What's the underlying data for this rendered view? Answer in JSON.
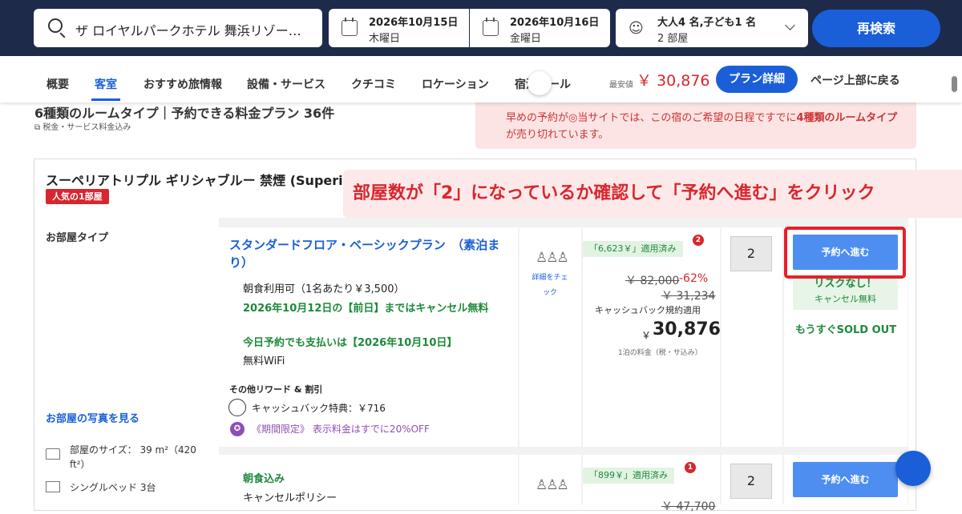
{
  "search": {
    "hotel": "ザ ロイヤルパークホテル 舞浜リゾー…",
    "checkin_date": "2026年10月15日",
    "checkin_day": "木曜日",
    "checkout_date": "2026年10月16日",
    "checkout_day": "金曜日",
    "guests": "大人4 名,子ども1 名",
    "rooms": "2 部屋",
    "button": "再検索"
  },
  "nav": {
    "tabs": [
      "概要",
      "客室",
      "おすすめ旅情報",
      "設備・サービス",
      "クチコミ",
      "ロケーション",
      "宿泊ルール"
    ],
    "active_tab": "客室",
    "lowest_label": "最安値",
    "lowest_price": "￥ 30,876",
    "plan_detail_button": "プラン詳細",
    "back_to_top": "ページ上部に戻る"
  },
  "summary": {
    "title": "6種類のルームタイプ｜予約できる料金プラン 36件",
    "tax_note": "税金・サービス料金込み",
    "alert_prefix": "早めの予約が◎当サイトでは、この宿のご希望の日程ですでに",
    "alert_bold": "4種類のルームタイプ",
    "alert_suffix": "が売り切れています。"
  },
  "annotation_banner": "部屋数が「2」になっているか確認して「予約へ進む」をクリック",
  "room": {
    "title": "スーペリアトリプル ギリシャブルー 禁煙 (Superior",
    "popular_badge": "人気の1部屋",
    "room_type_label": "お部屋タイプ",
    "photo_link": "お部屋の写真を見る",
    "size": "部屋のサイズ： 39 m²（420 ft²）",
    "beds": "シングルベッド 3台"
  },
  "plan1": {
    "name": "スタンダードフロア・ベーシックプラン　（素泊まり）",
    "breakfast": "朝食利用可（1名あたり￥3,500）",
    "cancel": "2026年10月12日の【前日】まではキャンセル無料",
    "pay": "今日予約でも支払いは【2026年10月10日】",
    "wifi": "無料WiFi",
    "rewards_title": "その他リワード & 割引",
    "cashback": "キャッシュバック特典：￥716",
    "limited": "《期間限定》 表示料金はすでに20%OFF",
    "detail_link": "詳細をチェック",
    "coupon": "「6,623￥」適用済み",
    "coupon_count": "2",
    "original_price": "￥ 82,000",
    "discount": "-62%",
    "price_after_coupon": "￥ 31,234",
    "cashback_rule": "キャッシュバック規約適用",
    "currency": "￥",
    "price": "30,876",
    "per_night": "1泊の料金（税・サ込み）",
    "quantity": "2",
    "reserve_button": "予約へ進む",
    "risk_main": "リスクなし！",
    "risk_sub": "キャンセル無料",
    "soldout": "もうすぐSOLD OUT"
  },
  "plan2": {
    "title": "朝食込み",
    "policy": "キャンセルポリシー",
    "coupon": "「899￥」適用済み",
    "coupon_count": "1",
    "original_price": "￥ 47,700",
    "quantity": "2",
    "reserve_button": "予約へ進む"
  },
  "colors": {
    "navy": "#1e2a4a",
    "accent_blue": "#1a5fd8",
    "red": "#d8262e",
    "green": "#1e8a3a",
    "purple": "#8e4fb5"
  }
}
